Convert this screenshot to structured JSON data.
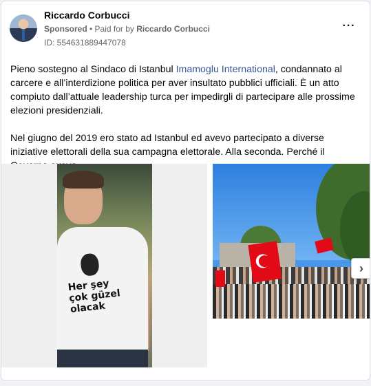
{
  "post": {
    "author_name": "Riccardo Corbucci",
    "sponsored_label": "Sponsored",
    "separator": " • ",
    "paid_for_prefix": "Paid for by ",
    "paid_for_name": "Riccardo Corbucci",
    "ad_id": "ID: 554631889447078",
    "more_label": "···",
    "body": {
      "line_part1": "Pieno sostegno al Sindaco di Istanbul ",
      "link_text": "Imamoglu International",
      "line_part2": ", condannato al carcere e all’interdizione politica per aver insultato pubblici ufficiali. È un atto compiuto dall’attuale leadership turca per impedirgli di partecipare alle prossime elezioni presidenziali.",
      "paragraph2": "Nel giugno del 2019 ero stato ad Istanbul ed avevo partecipato a diverse iniziative elettorali della sua campagna elettorale. Alla seconda. Perché il Governo aveva…"
    },
    "shirt_print_text": [
      "Her şey",
      "çok güzel",
      "olacak"
    ],
    "carousel_next_label": "›"
  },
  "colors": {
    "link": "#385898",
    "secondary_text": "#65676b",
    "card_border": "#dfe1e5",
    "flag_red": "#e30a17"
  },
  "icons": {
    "more": "more-options-icon",
    "next": "chevron-right-icon"
  }
}
